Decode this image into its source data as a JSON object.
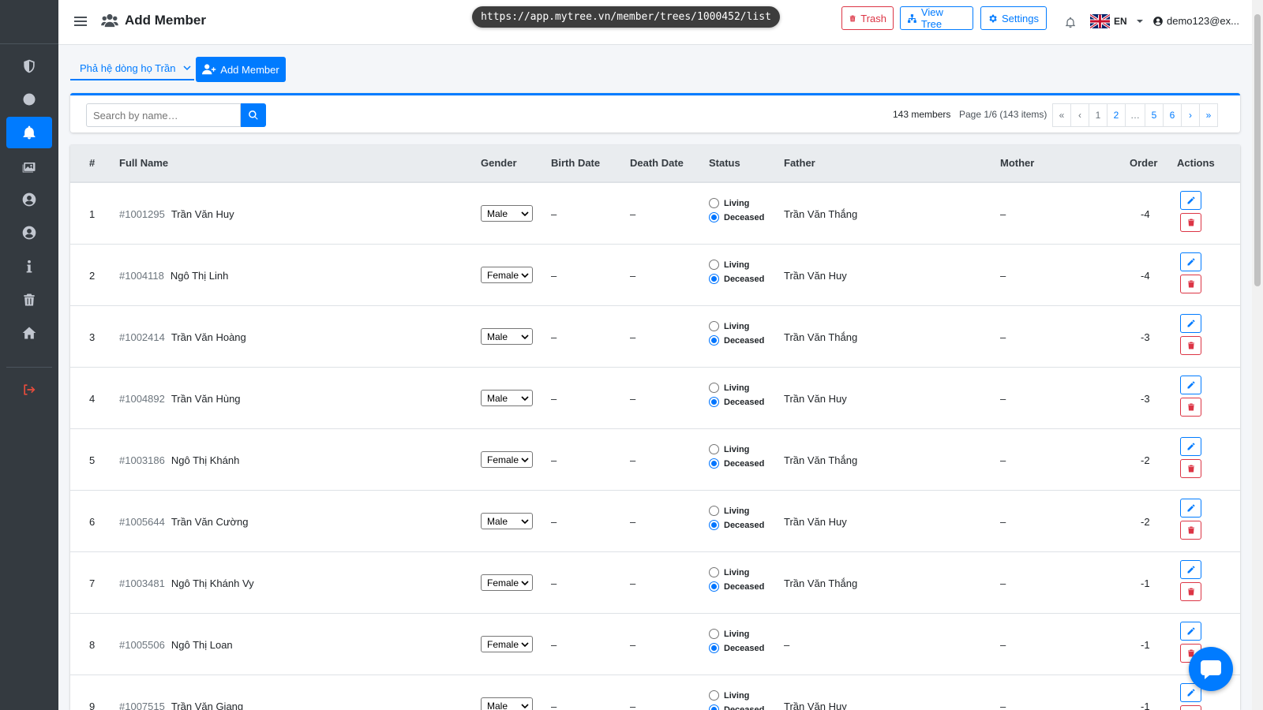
{
  "browser": {
    "url": "https://app.mytree.vn/member/trees/1000452/list"
  },
  "header": {
    "title": "Add Member",
    "trash_label": "Trash",
    "view_tree_label": "View Tree",
    "settings_label": "Settings",
    "language": "EN",
    "user": "demo123@ex..."
  },
  "sidebar": {
    "items": [
      {
        "icon": "shield-icon"
      },
      {
        "icon": "circle-icon"
      },
      {
        "icon": "bell-icon",
        "active": true
      },
      {
        "icon": "images-icon"
      },
      {
        "icon": "user-circle-icon"
      },
      {
        "icon": "user-circle-icon"
      },
      {
        "icon": "info-icon"
      },
      {
        "icon": "trash-icon"
      },
      {
        "icon": "home-icon"
      },
      {
        "icon": "sign-out-icon"
      }
    ]
  },
  "toolbar": {
    "tree_name": "Phả hệ dòng họ Trần",
    "add_member_label": "Add Member"
  },
  "search": {
    "placeholder": "Search by name…",
    "members_count": "143 members",
    "page_info": "Page 1/6 (143 items)",
    "pages": [
      "«",
      "‹",
      "1",
      "2",
      "…",
      "5",
      "6",
      "›",
      "»"
    ]
  },
  "table": {
    "headers": [
      "#",
      "Full Name",
      "Gender",
      "Birth Date",
      "Death Date",
      "Status",
      "Father",
      "Mother",
      "Order",
      "Actions"
    ],
    "status_living": "Living",
    "status_deceased": "Deceased",
    "rows": [
      {
        "n": "1",
        "id": "#1001295",
        "name": "Trần Văn Huy",
        "gender": "Male",
        "birth": "–",
        "death": "–",
        "status": "Deceased",
        "father": "Trần Văn Thắng",
        "mother": "–",
        "order": "-4"
      },
      {
        "n": "2",
        "id": "#1004118",
        "name": "Ngô Thị Linh",
        "gender": "Female",
        "birth": "–",
        "death": "–",
        "status": "Deceased",
        "father": "Trần Văn Huy",
        "mother": "–",
        "order": "-4"
      },
      {
        "n": "3",
        "id": "#1002414",
        "name": "Trần Văn Hoàng",
        "gender": "Male",
        "birth": "–",
        "death": "–",
        "status": "Deceased",
        "father": "Trần Văn Thắng",
        "mother": "–",
        "order": "-3"
      },
      {
        "n": "4",
        "id": "#1004892",
        "name": "Trần Văn Hùng",
        "gender": "Male",
        "birth": "–",
        "death": "–",
        "status": "Deceased",
        "father": "Trần Văn Huy",
        "mother": "–",
        "order": "-3"
      },
      {
        "n": "5",
        "id": "#1003186",
        "name": "Ngô Thị Khánh",
        "gender": "Female",
        "birth": "–",
        "death": "–",
        "status": "Deceased",
        "father": "Trần Văn Thắng",
        "mother": "–",
        "order": "-2"
      },
      {
        "n": "6",
        "id": "#1005644",
        "name": "Trần Văn Cường",
        "gender": "Male",
        "birth": "–",
        "death": "–",
        "status": "Deceased",
        "father": "Trần Văn Huy",
        "mother": "–",
        "order": "-2"
      },
      {
        "n": "7",
        "id": "#1003481",
        "name": "Ngô Thị Khánh Vy",
        "gender": "Female",
        "birth": "–",
        "death": "–",
        "status": "Deceased",
        "father": "Trần Văn Thắng",
        "mother": "–",
        "order": "-1"
      },
      {
        "n": "8",
        "id": "#1005506",
        "name": "Ngô Thị Loan",
        "gender": "Female",
        "birth": "–",
        "death": "–",
        "status": "Deceased",
        "father": "–",
        "mother": "–",
        "order": "-1"
      },
      {
        "n": "9",
        "id": "#1007515",
        "name": "Trần Văn Giang",
        "gender": "Male",
        "birth": "–",
        "death": "–",
        "status": "Deceased",
        "father": "Trần Văn Huy",
        "mother": "–",
        "order": "-1"
      }
    ]
  },
  "colors": {
    "primary": "#007bff",
    "danger": "#dc3545",
    "sidebar": "#343a40"
  }
}
